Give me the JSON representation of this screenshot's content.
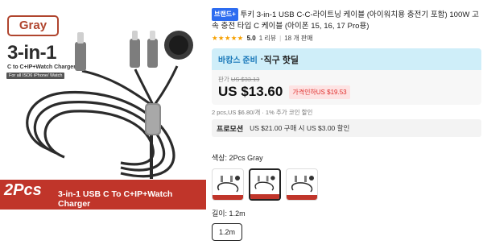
{
  "image": {
    "color_tag": "Gray",
    "title": "3-in-1",
    "subtitle": "C to C+IP+Watch Charger",
    "subtitle_small": "For all ISO6 iPhone/ Watch",
    "banner_count": "2Pcs",
    "banner_text": "3-in-1 USB C To C+IP+Watch Charger",
    "accent_color": "#c0352a"
  },
  "product": {
    "brand_badge": "브랜드+",
    "title": "투키 3-in-1 USB C-C-라이트닝 케이블 (아이워치용 충전기 포함) 100W 고속 충전 타입 C 케이블 (아이폰 15, 16, 17 Pro용)",
    "stars": "★★★★★",
    "rating": "5.0",
    "sold": "1 리뷰",
    "sales": "18 개 판매"
  },
  "deal": {
    "label_prefix": "바캉스 준비",
    "label_dot": " · ",
    "label_main": "직구 핫딜",
    "original_prefix": "판가",
    "original_price": "US $33.13",
    "price": "US $13.60",
    "discount": "가격인하US $19.53",
    "header_color": "#cfeef9"
  },
  "unit_price": "2 pcs,US $6.80/개 · 1% 추가 코인 할인",
  "promo": {
    "label": "프로모션",
    "text": "US $21.00 구매 시 US $3.00 할인"
  },
  "color": {
    "label": "색상: 2Pcs Gray",
    "selected_index": 1,
    "swatch_count": 3
  },
  "length": {
    "label": "길이: 1.2m",
    "option": "1.2m"
  },
  "icons": [
    "cable-icon",
    "star-icon"
  ]
}
